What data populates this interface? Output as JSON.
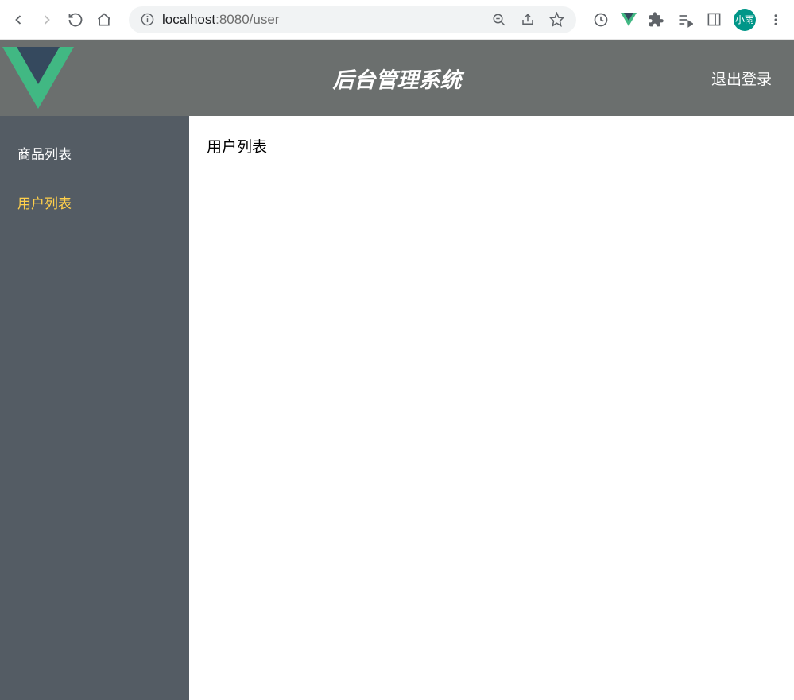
{
  "browser": {
    "url_host": "localhost",
    "url_port_path": ":8080/user",
    "avatar_text": "小雨"
  },
  "header": {
    "title": "后台管理系统",
    "logout_label": "退出登录"
  },
  "sidebar": {
    "items": [
      {
        "label": "商品列表",
        "active": false
      },
      {
        "label": "用户列表",
        "active": true
      }
    ]
  },
  "main": {
    "page_title": "用户列表"
  }
}
